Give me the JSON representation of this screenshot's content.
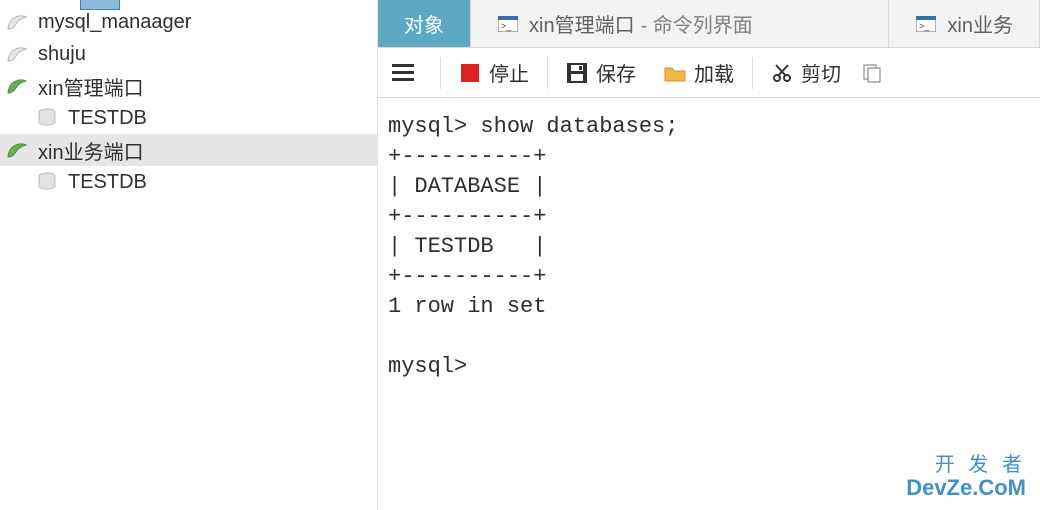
{
  "tree": [
    {
      "label": "mysql_manaager",
      "type": "conn",
      "active": false
    },
    {
      "label": "shuju",
      "type": "conn",
      "active": false
    },
    {
      "label": "xin管理端口",
      "type": "conn",
      "active": true
    },
    {
      "label": "TESTDB",
      "type": "db"
    },
    {
      "label": "xin业务端口",
      "type": "conn",
      "active": true,
      "selected": true
    },
    {
      "label": "TESTDB",
      "type": "db"
    }
  ],
  "tabs": {
    "t0": "对象",
    "t1": "xin管理端口",
    "t1_sub": " - 命令列界面",
    "t2": "xin业务"
  },
  "toolbar": {
    "stop": "停止",
    "save": "保存",
    "load": "加载",
    "cut": "剪切"
  },
  "console_text": "mysql> show databases;\n+----------+\n| DATABASE |\n+----------+\n| TESTDB   |\n+----------+\n1 row in set\n\nmysql>",
  "watermark": {
    "line1": "开 发 者",
    "line2": "DevZe.CoM"
  }
}
